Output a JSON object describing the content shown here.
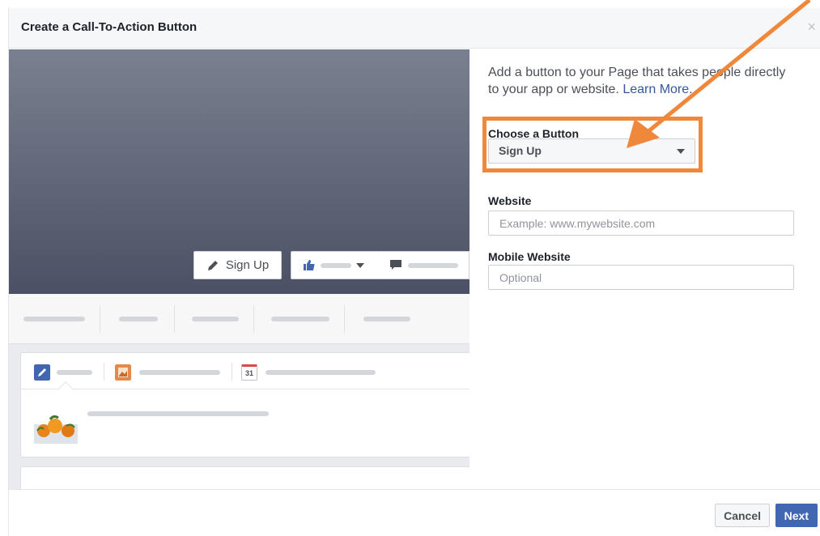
{
  "dialog": {
    "title": "Create a Call-To-Action Button",
    "close_glyph": "×"
  },
  "preview": {
    "cta_label": "Sign Up",
    "calendar_day": "31"
  },
  "form": {
    "description": "Add a button to your Page that takes people directly to your app or website.",
    "learn_more": "Learn More.",
    "choose_label": "Choose a Button",
    "choose_value": "Sign Up",
    "website_label": "Website",
    "website_placeholder": "Example: www.mywebsite.com",
    "mobile_label": "Mobile Website",
    "mobile_placeholder": "Optional"
  },
  "footer": {
    "cancel_label": "Cancel",
    "next_label": "Next"
  },
  "colors": {
    "accent": "#4267b2",
    "link": "#365899",
    "highlight": "#f0883c"
  },
  "icons": [
    "pencil-icon",
    "thumbs-up-icon",
    "caret-down-icon",
    "message-icon",
    "status-icon",
    "photo-icon",
    "calendar-icon",
    "close-icon",
    "annotation-arrow"
  ]
}
